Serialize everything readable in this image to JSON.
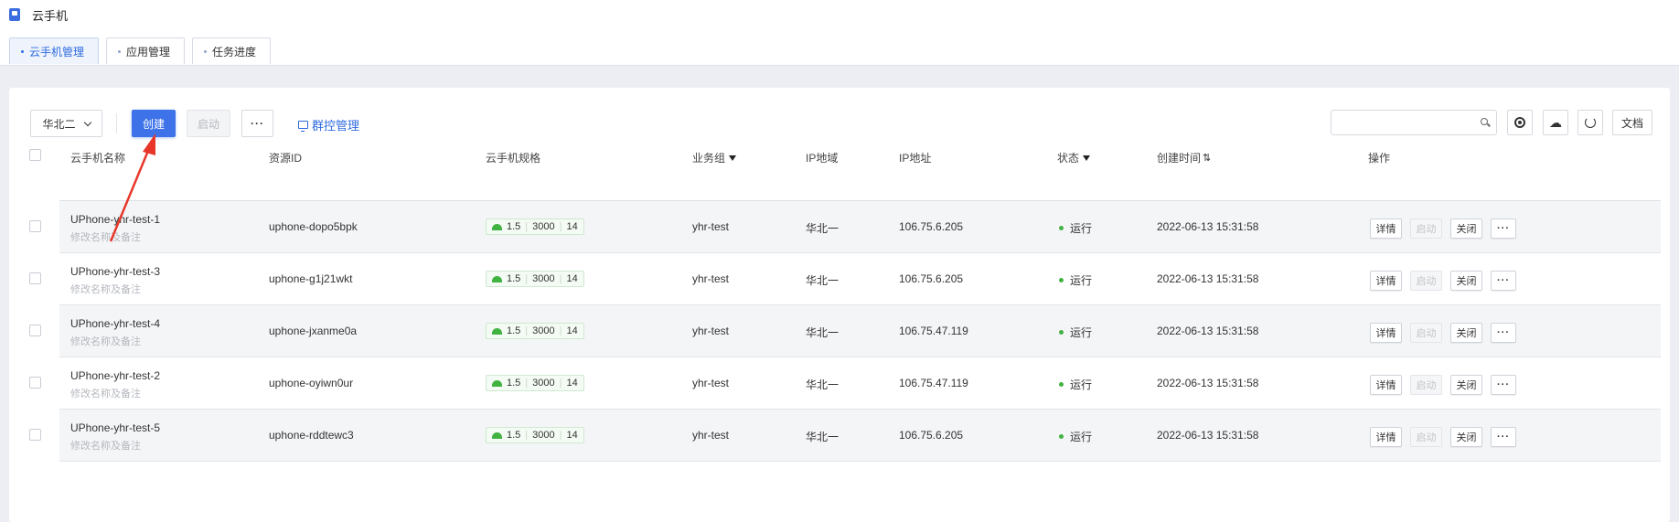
{
  "app": {
    "title": "云手机"
  },
  "tabs": [
    {
      "label": "云手机管理",
      "active": true
    },
    {
      "label": "应用管理",
      "active": false
    },
    {
      "label": "任务进度",
      "active": false
    }
  ],
  "toolbar": {
    "region": "华北二",
    "create_label": "创建",
    "start_label": "启动",
    "more_label": "···",
    "group_control_label": "群控管理",
    "search_placeholder": "",
    "doc_label": "文档"
  },
  "table": {
    "columns": [
      "云手机名称",
      "资源ID",
      "云手机规格",
      "业务组",
      "IP地域",
      "IP地址",
      "状态",
      "创建时间",
      "操作"
    ],
    "rows": [
      {
        "name": "UPhone-yhr-test-1",
        "remark": "修改名称及备注",
        "id": "uphone-dopo5bpk",
        "spec": [
          "1.5",
          "3000",
          "14"
        ],
        "group": "yhr-test",
        "region": "华北一",
        "ip": "106.75.6.205",
        "status": "运行",
        "created": "2022-06-13 15:31:58"
      },
      {
        "name": "UPhone-yhr-test-3",
        "remark": "修改名称及备注",
        "id": "uphone-g1j21wkt",
        "spec": [
          "1.5",
          "3000",
          "14"
        ],
        "group": "yhr-test",
        "region": "华北一",
        "ip": "106.75.6.205",
        "status": "运行",
        "created": "2022-06-13 15:31:58"
      },
      {
        "name": "UPhone-yhr-test-4",
        "remark": "修改名称及备注",
        "id": "uphone-jxanme0a",
        "spec": [
          "1.5",
          "3000",
          "14"
        ],
        "group": "yhr-test",
        "region": "华北一",
        "ip": "106.75.47.119",
        "status": "运行",
        "created": "2022-06-13 15:31:58"
      },
      {
        "name": "UPhone-yhr-test-2",
        "remark": "修改名称及备注",
        "id": "uphone-oyiwn0ur",
        "spec": [
          "1.5",
          "3000",
          "14"
        ],
        "group": "yhr-test",
        "region": "华北一",
        "ip": "106.75.47.119",
        "status": "运行",
        "created": "2022-06-13 15:31:58"
      },
      {
        "name": "UPhone-yhr-test-5",
        "remark": "修改名称及备注",
        "id": "uphone-rddtewc3",
        "spec": [
          "1.5",
          "3000",
          "14"
        ],
        "group": "yhr-test",
        "region": "华北一",
        "ip": "106.75.6.205",
        "status": "运行",
        "created": "2022-06-13 15:31:58"
      }
    ],
    "actions": {
      "detail": "详情",
      "start": "启动",
      "close": "关闭",
      "more": "···"
    }
  },
  "colors": {
    "accent": "#3e72e8",
    "status_running": "#43b243",
    "annotation_arrow": "#e8372a"
  }
}
